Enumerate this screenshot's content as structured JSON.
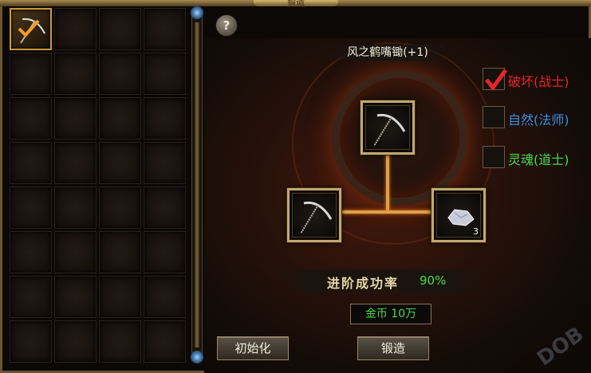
{
  "window": {
    "title": "锻造"
  },
  "help": {
    "label": "?"
  },
  "inventory": {
    "rows": 8,
    "cols": 4,
    "selected_index": 0
  },
  "forge": {
    "item_name": "风之鹤嘴锄(+1)",
    "material_count": "3",
    "success_label": "进阶成功率",
    "success_rate": "90%",
    "gold_cost": "金币 10万"
  },
  "options": [
    {
      "label": "破坏(战士)",
      "checked": true,
      "color": "#e8242a"
    },
    {
      "label": "自然(法师)",
      "checked": false,
      "color": "#3a8fe0"
    },
    {
      "label": "灵魂(道士)",
      "checked": false,
      "color": "#49d94b"
    }
  ],
  "buttons": {
    "reset": "初始化",
    "forge": "锻造"
  },
  "colors": {
    "accent_gold": "#c2a870",
    "success_green": "#49d94b",
    "frame": "#6b5530"
  }
}
